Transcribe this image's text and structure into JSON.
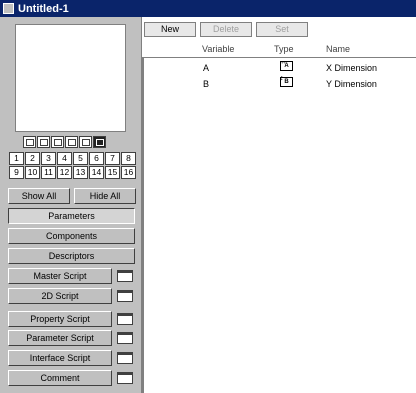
{
  "window": {
    "title": "Untitled-1"
  },
  "toolbar": {
    "new_label": "New",
    "delete_label": "Delete",
    "set_label": "Set"
  },
  "columns": {
    "variable": "Variable",
    "type": "Type",
    "name": "Name"
  },
  "parameters": [
    {
      "variable": "A",
      "type_icon": "x-dimension-icon",
      "type_text": "A",
      "name": "X Dimension"
    },
    {
      "variable": "B",
      "type_icon": "y-dimension-icon",
      "type_text": "B",
      "name": "Y Dimension"
    }
  ],
  "grid_numbers": [
    "1",
    "2",
    "3",
    "4",
    "5",
    "6",
    "7",
    "8",
    "9",
    "10",
    "11",
    "12",
    "13",
    "14",
    "15",
    "16"
  ],
  "buttons": {
    "show_all": "Show All",
    "hide_all": "Hide All",
    "parameters": "Parameters",
    "components": "Components",
    "descriptors": "Descriptors",
    "master_script": "Master Script",
    "script_2d": "2D Script",
    "property_script": "Property Script",
    "parameter_script": "Parameter Script",
    "interface_script": "Interface Script",
    "comment": "Comment"
  }
}
